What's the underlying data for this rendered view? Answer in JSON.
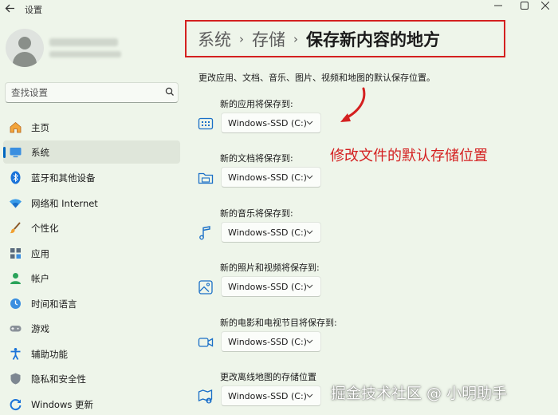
{
  "window": {
    "title": "设置"
  },
  "sidebar": {
    "search_placeholder": "查找设置",
    "items": [
      {
        "label": "主页",
        "icon": "home-icon"
      },
      {
        "label": "系统",
        "icon": "system-icon",
        "selected": true
      },
      {
        "label": "蓝牙和其他设备",
        "icon": "bluetooth-icon"
      },
      {
        "label": "网络和 Internet",
        "icon": "network-icon"
      },
      {
        "label": "个性化",
        "icon": "brush-icon"
      },
      {
        "label": "应用",
        "icon": "apps-icon"
      },
      {
        "label": "帐户",
        "icon": "account-icon"
      },
      {
        "label": "时间和语言",
        "icon": "time-language-icon"
      },
      {
        "label": "游戏",
        "icon": "gaming-icon"
      },
      {
        "label": "辅助功能",
        "icon": "accessibility-icon"
      },
      {
        "label": "隐私和安全性",
        "icon": "shield-icon"
      },
      {
        "label": "Windows 更新",
        "icon": "windows-update-icon"
      }
    ]
  },
  "header": {
    "breadcrumb": [
      "系统",
      "存储"
    ],
    "current": "保存新内容的地方"
  },
  "main": {
    "description": "更改应用、文档、音乐、图片、视频和地图的默认保存位置。",
    "rows": [
      {
        "label": "新的应用将保存到:",
        "value": "Windows-SSD (C:)",
        "icon": "apps-storage-icon"
      },
      {
        "label": "新的文档将保存到:",
        "value": "Windows-SSD (C:)",
        "icon": "documents-folder-icon"
      },
      {
        "label": "新的音乐将保存到:",
        "value": "Windows-SSD (C:)",
        "icon": "music-note-icon"
      },
      {
        "label": "新的照片和视频将保存到:",
        "value": "Windows-SSD (C:)",
        "icon": "photo-icon"
      },
      {
        "label": "新的电影和电视节目将保存到:",
        "value": "Windows-SSD (C:)",
        "icon": "video-camera-icon"
      },
      {
        "label": "更改离线地图的存储位置",
        "value": "Windows-SSD (C:)",
        "icon": "offline-map-icon"
      }
    ]
  },
  "annotation": {
    "text": "修改文件的默认存储位置",
    "color": "#d42020"
  },
  "watermark": {
    "text": "掘金技术社区 @ 小明助手"
  },
  "colors": {
    "background": "#eef5ea",
    "accent": "#0067c0",
    "highlight_border": "#d42020"
  }
}
